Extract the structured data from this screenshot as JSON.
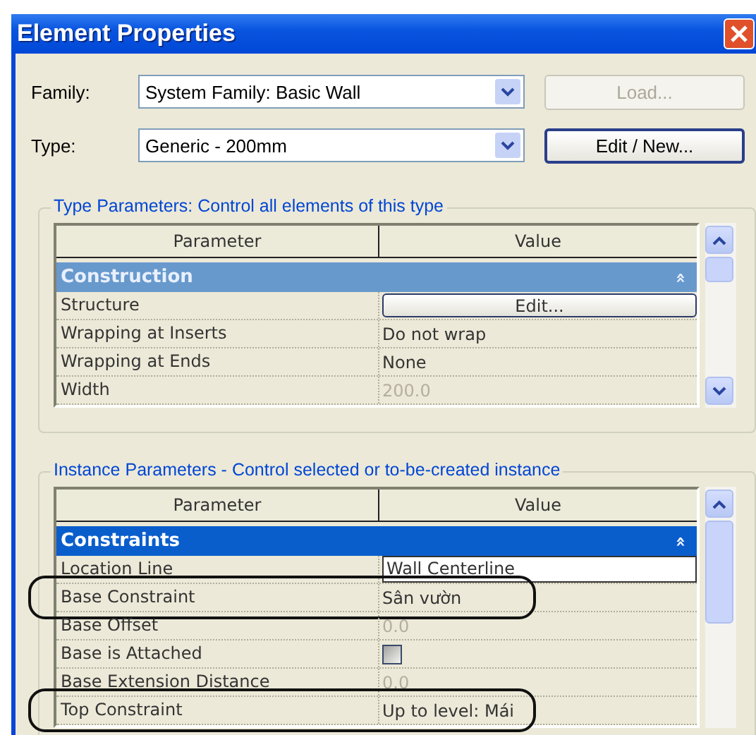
{
  "window": {
    "title": "Element Properties"
  },
  "family": {
    "label": "Family:",
    "value": "System Family: Basic Wall",
    "button": {
      "label": "Load...",
      "disabled": true
    }
  },
  "type": {
    "label": "Type:",
    "value": "Generic - 200mm",
    "button": {
      "label": "Edit / New...",
      "disabled": false
    }
  },
  "type_parameters": {
    "title": "Type Parameters: Control all elements of this type",
    "columns": [
      "Parameter",
      "Value"
    ],
    "groups": [
      {
        "name": "Construction",
        "toggle": "»",
        "focused": false,
        "rows": [
          {
            "name": "Structure",
            "kind": "button",
            "value": "Edit...",
            "disabled": false,
            "circled": false
          },
          {
            "name": "Wrapping at Inserts",
            "kind": "text",
            "value": "Do not wrap",
            "disabled": false,
            "circled": false
          },
          {
            "name": "Wrapping at Ends",
            "kind": "text",
            "value": "None",
            "disabled": false,
            "circled": false
          },
          {
            "name": "Width",
            "kind": "text",
            "value": "200.0",
            "disabled": true,
            "circled": false
          }
        ]
      }
    ]
  },
  "instance_parameters": {
    "title": "Instance Parameters - Control selected or to-be-created instance",
    "columns": [
      "Parameter",
      "Value"
    ],
    "groups": [
      {
        "name": "Constraints",
        "toggle": "»",
        "focused": true,
        "rows": [
          {
            "name": "Location Line",
            "kind": "field",
            "value": "Wall Centerline",
            "disabled": false,
            "circled": false
          },
          {
            "name": "Base Constraint",
            "kind": "text",
            "value": "Sân vườn",
            "disabled": false,
            "circled": true
          },
          {
            "name": "Base Offset",
            "kind": "text",
            "value": "0.0",
            "disabled": true,
            "circled": false
          },
          {
            "name": "Base is Attached",
            "kind": "checkbox",
            "checked": false,
            "disabled": false,
            "circled": false
          },
          {
            "name": "Base Extension Distance",
            "kind": "text",
            "value": "0.0",
            "disabled": true,
            "circled": false
          },
          {
            "name": "Top Constraint",
            "kind": "text",
            "value": "Up to level: Mái",
            "disabled": false,
            "circled": true
          }
        ]
      }
    ]
  }
}
